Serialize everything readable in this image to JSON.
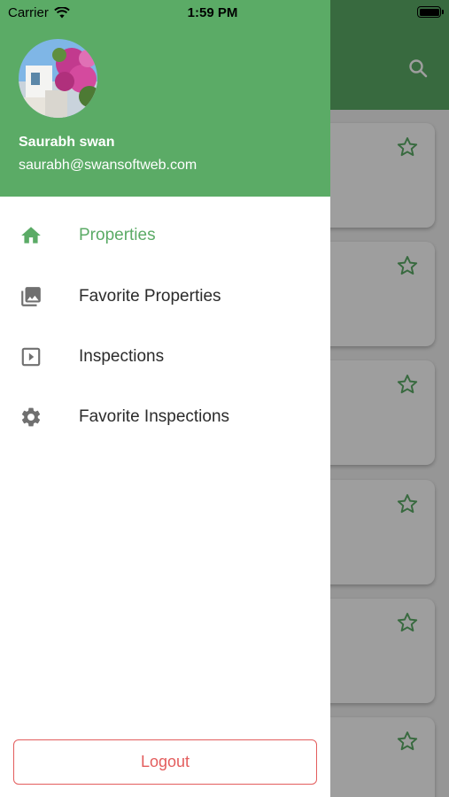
{
  "status_bar": {
    "carrier": "Carrier",
    "time": "1:59 PM"
  },
  "drawer": {
    "user_name": "Saurabh swan",
    "user_email": "saurabh@swansoftweb.com",
    "menu": [
      {
        "label": "Properties",
        "icon": "home-icon",
        "active": true
      },
      {
        "label": "Favorite Properties",
        "icon": "photo-library-icon",
        "active": false
      },
      {
        "label": "Inspections",
        "icon": "play-box-icon",
        "active": false
      },
      {
        "label": "Favorite Inspections",
        "icon": "gear-icon",
        "active": false
      }
    ],
    "logout_label": "Logout"
  },
  "colors": {
    "accent": "#5bab66",
    "danger": "#e35d5d",
    "icon_gray": "#707070"
  }
}
